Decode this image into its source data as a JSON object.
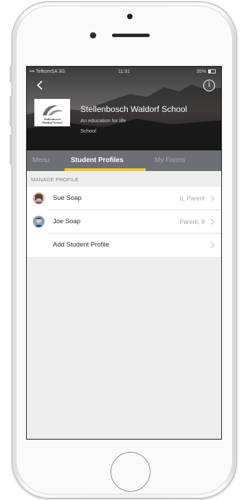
{
  "status": {
    "carrier": "••• TelkomSA  3G",
    "time": "11:31",
    "battery": "35%"
  },
  "school": {
    "name": "Stellenbosch Waldorf School",
    "tagline": "An education for life",
    "type": "School",
    "logo_line1": "Stellenbosch",
    "logo_line2": "Waldorf School"
  },
  "tabs": [
    {
      "label": "Menu",
      "active": false
    },
    {
      "label": "Student Profiles",
      "active": true
    },
    {
      "label": "My Forms",
      "active": false
    }
  ],
  "section": {
    "title": "MANAGE PROFILE"
  },
  "profiles": [
    {
      "name": "Sue Soap",
      "detail": "6, Parent"
    },
    {
      "name": "Joe Soap",
      "detail": "Parent, 9"
    }
  ],
  "add_profile_label": "Add Student Profile",
  "icons": {
    "back": "chevron-left-icon",
    "info": "info-icon",
    "row": "chevron-right-icon"
  },
  "colors": {
    "accent": "#f7c325",
    "tabbar": "#6b7077",
    "background": "#eeeeee"
  }
}
